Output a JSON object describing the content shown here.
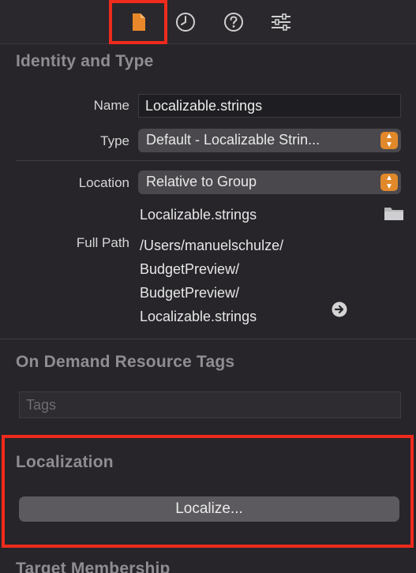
{
  "toolbar": {
    "icons": [
      "file-inspector-icon",
      "history-icon",
      "help-icon",
      "attributes-icon"
    ],
    "active": "file-inspector-icon",
    "active_color": "#e8882a"
  },
  "identity": {
    "title": "Identity and Type",
    "name_label": "Name",
    "name_value": "Localizable.strings",
    "type_label": "Type",
    "type_value": "Default - Localizable Strin...",
    "location_label": "Location",
    "location_value": "Relative to Group",
    "location_file": "Localizable.strings",
    "full_path_label": "Full Path",
    "full_path_lines": [
      "/Users/manuelschulze/",
      "BudgetPreview/",
      "BudgetPreview/",
      "Localizable.strings"
    ]
  },
  "on_demand": {
    "title": "On Demand Resource Tags",
    "tags_placeholder": "Tags"
  },
  "localization": {
    "title": "Localization",
    "button_label": "Localize..."
  },
  "target_membership": {
    "title": "Target Membership"
  },
  "highlight_color": "#ef2b1d"
}
